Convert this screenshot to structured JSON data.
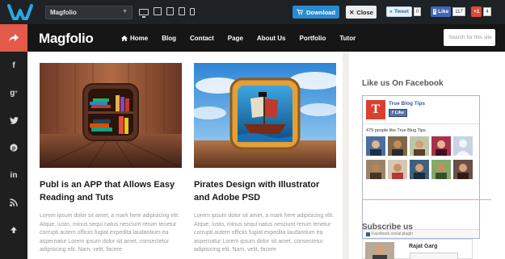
{
  "topbar": {
    "theme_name": "Magfolio",
    "download_label": "Download",
    "close_label": "Close",
    "tweet_label": "Tweet",
    "tweet_count": "0",
    "fb_like_label": "Like",
    "fb_like_count": "117",
    "gplus_label": "+1",
    "gplus_count": "4"
  },
  "header": {
    "brand": "Magfolio",
    "nav": [
      "Home",
      "Blog",
      "Contact",
      "Page",
      "About Us",
      "Portfolio",
      "Tutor"
    ],
    "search_placeholder": "Search for this site"
  },
  "posts": [
    {
      "title": "Publ is an APP that Allows Easy Reading and Tuts",
      "excerpt": "Lorem ipsum dolor sit amet, a mark here adipisicing elit. Atque, iusto, minus sequi natus nesciunt rerum tenetur corrupti autem officiis fugiat expedita laudantium ea aspernatur Lorem ipsum dolor sit amet, consectetur adipisicing elit. Nam, velit, facere"
    },
    {
      "title": "Pirates Design with Illustrator and Adobe PSD",
      "excerpt": "Lorem ipsum dolor sit amet, a mark here adipisicing elit. Atque, iusto, minus sequi natus nesciunt rerum tenetur corrupti autem officiis fugiat expedita laudantium ea aspernatur Lorem ipsum dolor sit amet, consectetur adipisicing elit. Nam, velit, facere"
    }
  ],
  "widgets": {
    "facebook_title": "Like us On Facebook",
    "fb_page_name": "True Blog Tips",
    "fb_like_label": "Like",
    "fb_people_text": "479 people like True Blog Tips.",
    "fb_footer": "Facebook social plugin",
    "subscribe_title": "Subscribe us",
    "subscriber_name": "Rajat Garg"
  },
  "colors": {
    "topbar_bg": "#1f2224",
    "header_bg": "#161616",
    "accent": "#e35a4a",
    "download_blue": "#2a8bd0",
    "facebook_blue": "#3b5998"
  },
  "icons": {
    "social_column": [
      "share-icon",
      "facebook-icon",
      "google-plus-icon",
      "twitter-icon",
      "pinterest-icon",
      "linkedin-icon",
      "rss-icon",
      "arrow-up-icon"
    ]
  }
}
